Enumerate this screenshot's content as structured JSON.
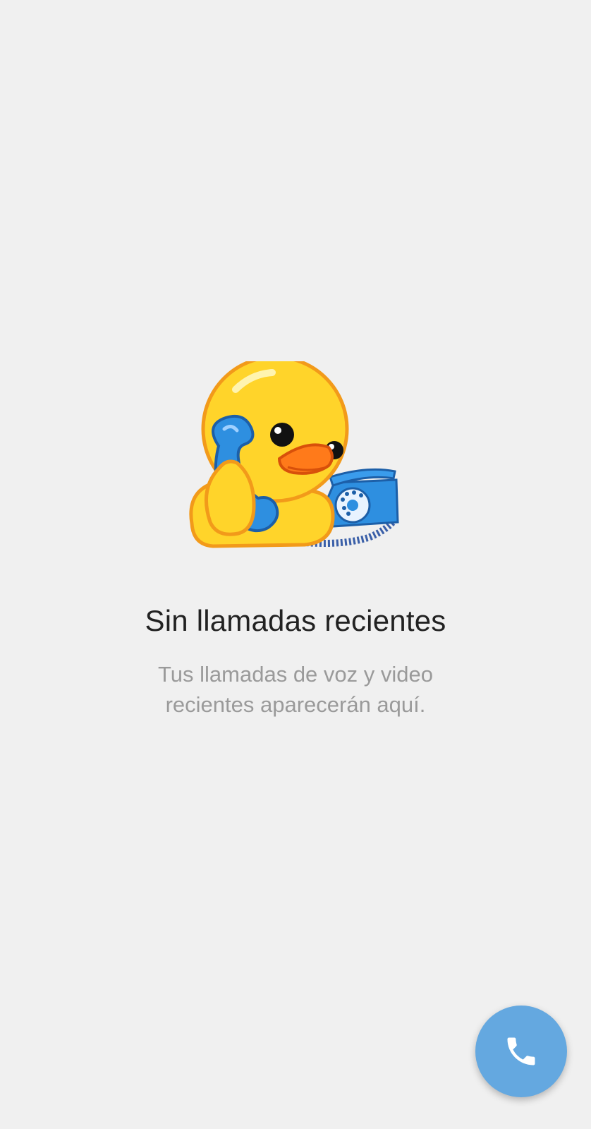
{
  "empty_state": {
    "illustration": "duck-on-phone-sticker",
    "title": "Sin llamadas recientes",
    "subtitle_line1": "Tus llamadas de voz y video",
    "subtitle_line2": "recientes aparecerán aquí."
  },
  "fab": {
    "icon": "phone-icon",
    "color": "#64a8e0"
  },
  "colors": {
    "background": "#f0f0f0",
    "title": "#222222",
    "subtitle": "#9a9a9a",
    "accent": "#64a8e0"
  }
}
